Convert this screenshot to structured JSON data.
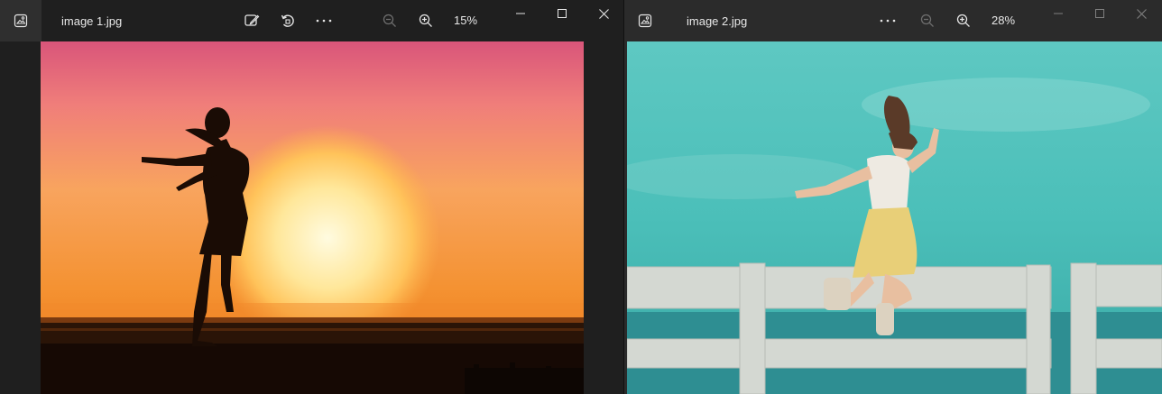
{
  "window1": {
    "title": "image 1.jpg",
    "zoom": "15%",
    "icons": [
      "photos-app-icon",
      "edit-image-icon",
      "rotate-icon",
      "more-options-icon",
      "zoom-out-icon",
      "zoom-in-icon",
      "minimize-icon",
      "maximize-icon",
      "close-icon"
    ]
  },
  "window2": {
    "title": "image 2.jpg",
    "zoom": "28%",
    "icons": [
      "photos-app-icon",
      "more-options-icon",
      "zoom-out-icon",
      "zoom-in-icon",
      "minimize-icon",
      "maximize-icon",
      "close-icon"
    ]
  },
  "colors": {
    "titlebar_bg": "#1f1f1f",
    "sunset_top": "#d9557a",
    "sunset_mid": "#f59a3a",
    "sky_teal": "#4fc2bc"
  }
}
